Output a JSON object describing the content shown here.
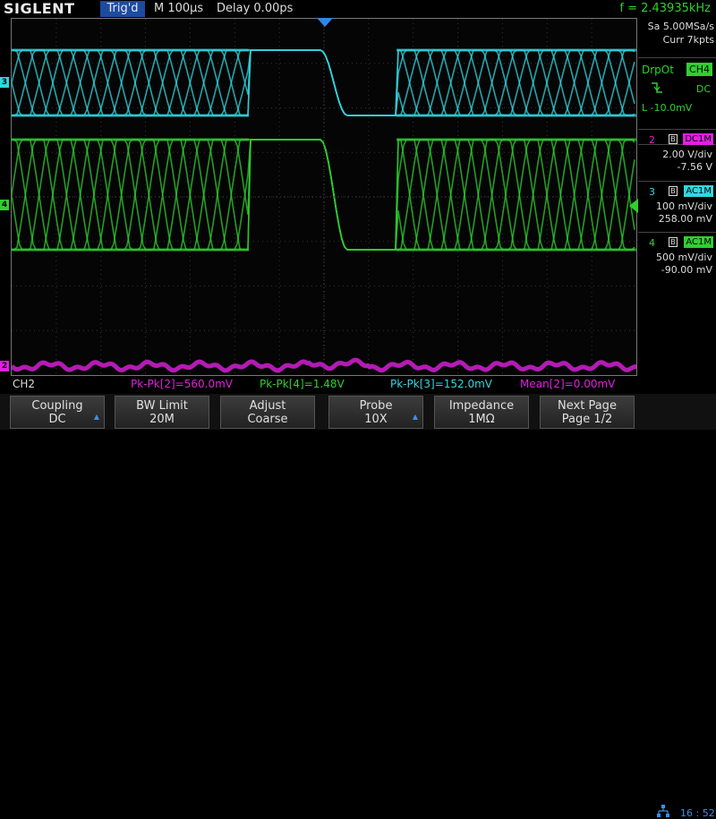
{
  "top": {
    "brand": "SIGLENT",
    "trigger_state": "Trig'd",
    "timebase": "M 100µs",
    "delay": "Delay 0.00ps",
    "frequency": "f = 2.43935kHz"
  },
  "acquisition": {
    "sample_rate": "Sa 5.00MSa/s",
    "memory": "Curr 7kpts"
  },
  "trigger": {
    "type": "DrpOt",
    "source": "CH4",
    "coupling": "DC",
    "level": "L  -10.0mV"
  },
  "channels": [
    {
      "num": "2",
      "coupling": "DC1M",
      "vdiv": "2.00 V/div",
      "offset": "-7.56 V",
      "color": "#e020e0"
    },
    {
      "num": "3",
      "coupling": "AC1M",
      "vdiv": "100 mV/div",
      "offset": "258.00 mV",
      "color": "#30d8e0"
    },
    {
      "num": "4",
      "coupling": "AC1M",
      "vdiv": "500 mV/div",
      "offset": "-90.00 mV",
      "color": "#2fd02f"
    }
  ],
  "markers": {
    "ch3": "3",
    "ch4": "4",
    "ch2": "2"
  },
  "measurements": {
    "channel": "CH2",
    "items": [
      {
        "text": "Pk-Pk[2]=560.0mV",
        "color": "#e020e0"
      },
      {
        "text": "Pk-Pk[4]=1.48V",
        "color": "#2fd02f"
      },
      {
        "text": "Pk-Pk[3]=152.0mV",
        "color": "#30d8e0"
      },
      {
        "text": "Mean[2]=0.00mV",
        "color": "#e020e0"
      }
    ]
  },
  "softkeys": [
    {
      "line1": "Coupling",
      "line2": "DC",
      "has_arrow": true
    },
    {
      "line1": "BW Limit",
      "line2": "20M",
      "has_arrow": false
    },
    {
      "line1": "Adjust",
      "line2": "Coarse",
      "has_arrow": false
    },
    {
      "line1": "Probe",
      "line2": "10X",
      "has_arrow": true
    },
    {
      "line1": "Impedance",
      "line2": "1MΩ",
      "has_arrow": false
    },
    {
      "line1": "Next Page",
      "line2": "Page 1/2",
      "has_arrow": false
    }
  ],
  "status": {
    "clock": "16 : 52",
    "network_icon": "network-icon"
  },
  "colors": {
    "ch2": "#e020e0",
    "ch3": "#30d8e0",
    "ch4": "#2fd02f",
    "trigger": "#2f86e8"
  }
}
